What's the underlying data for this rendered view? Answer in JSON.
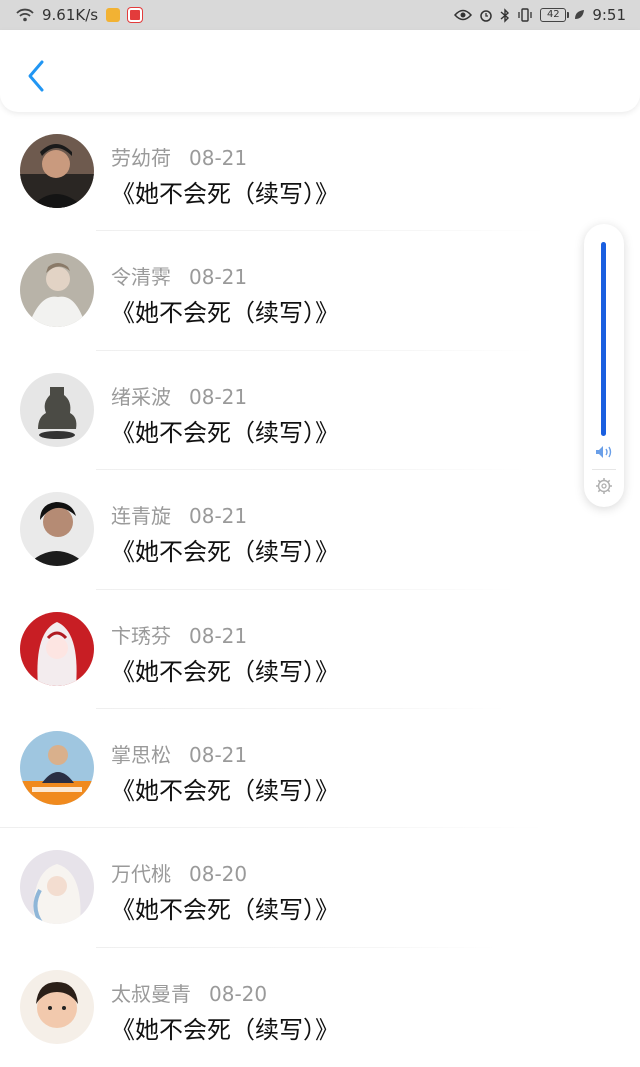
{
  "status_bar": {
    "network_speed": "9.61K/s",
    "battery_level": "42",
    "time": "9:51"
  },
  "header": {
    "back_icon": "chevron-left-icon",
    "accent_color": "#2196F3"
  },
  "items": [
    {
      "name": "劳幼荷",
      "date": "08-21",
      "title": "《她不会死（续写）》",
      "avatar": "avatar-man-dark"
    },
    {
      "name": "令清霁",
      "date": "08-21",
      "title": "《她不会死（续写）》",
      "avatar": "avatar-person-white"
    },
    {
      "name": "绪采波",
      "date": "08-21",
      "title": "《她不会死（续写）》",
      "avatar": "avatar-bronze-vessel"
    },
    {
      "name": "连青旋",
      "date": "08-21",
      "title": "《她不会死（续写）》",
      "avatar": "avatar-man-portrait"
    },
    {
      "name": "卞琇芬",
      "date": "08-21",
      "title": "《她不会死（续写）》",
      "avatar": "avatar-anime-red"
    },
    {
      "name": "掌思松",
      "date": "08-21",
      "title": "《她不会死（续写）》",
      "avatar": "avatar-boy-orange"
    },
    {
      "name": "万代桃",
      "date": "08-20",
      "title": "《她不会死（续写）》",
      "avatar": "avatar-anime-blue"
    },
    {
      "name": "太叔曼青",
      "date": "08-20",
      "title": "《她不会死（续写）》",
      "avatar": "avatar-child"
    }
  ],
  "volume": {
    "level": 1.0,
    "color": "#1A5FE0",
    "speaker_icon": "speaker-icon",
    "settings_icon": "gear-icon"
  }
}
